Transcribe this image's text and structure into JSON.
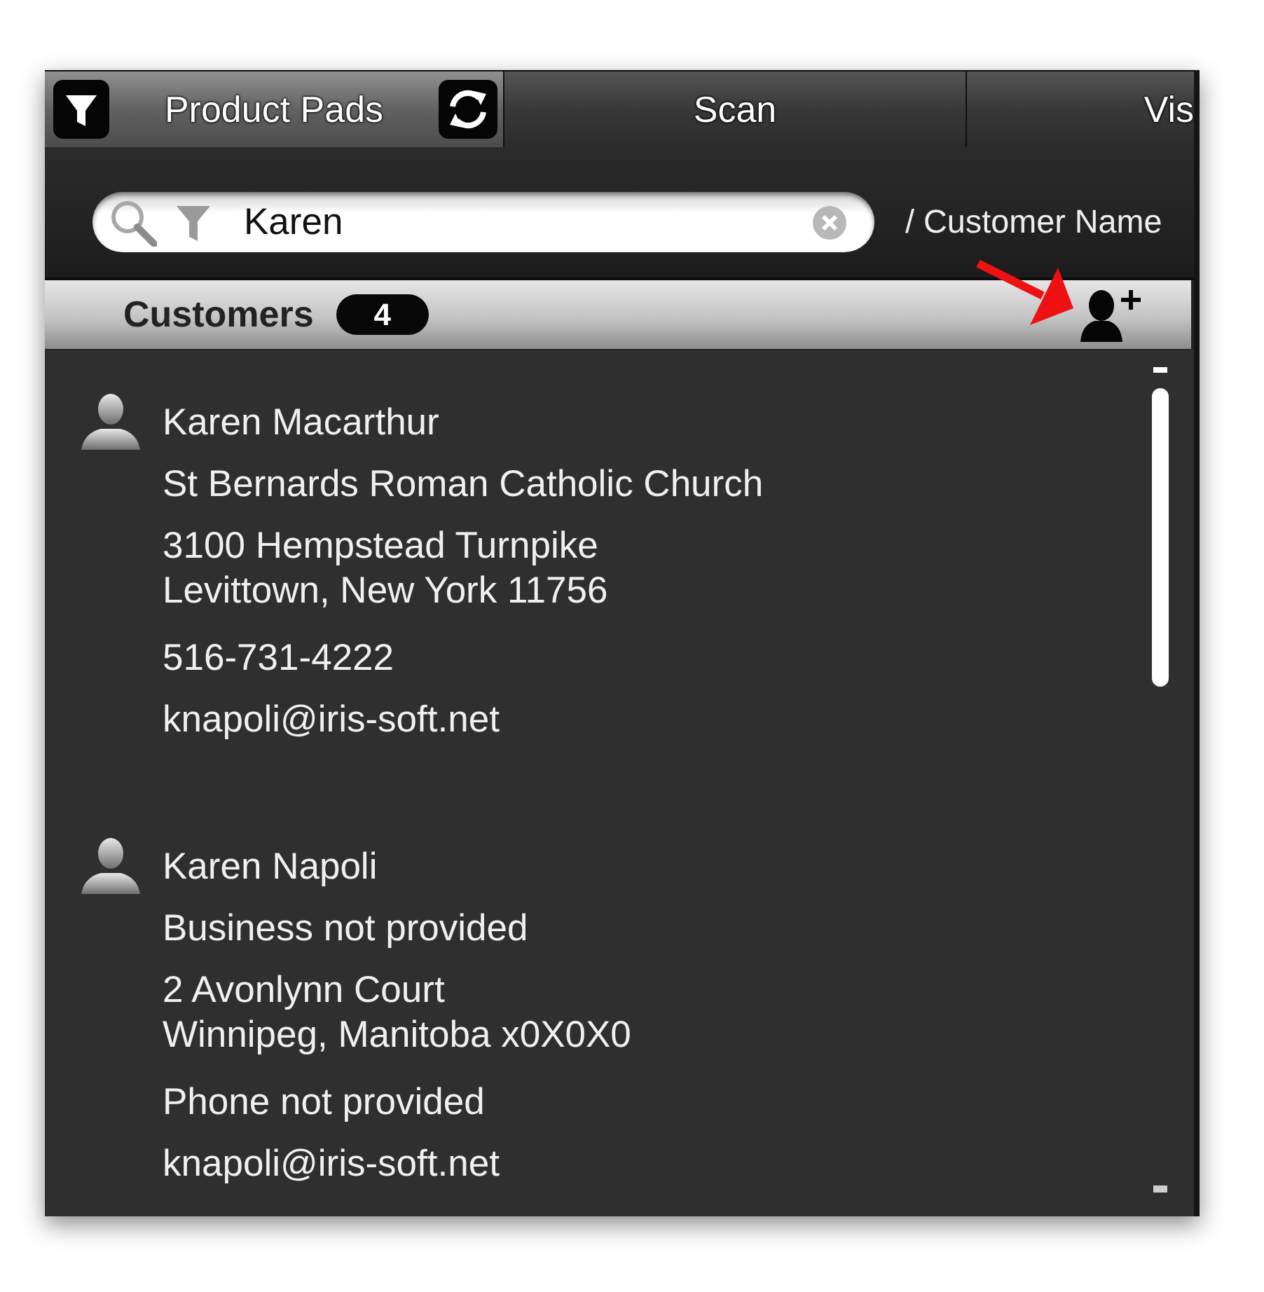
{
  "tabs": [
    {
      "label": "Product Pads",
      "selected": true
    },
    {
      "label": "Scan",
      "selected": false
    },
    {
      "label": "Vis",
      "selected": false
    }
  ],
  "search": {
    "value": "Karen",
    "field_label": "/ Customer Name"
  },
  "customers_header": {
    "title": "Customers",
    "count": "4"
  },
  "customers": [
    {
      "name": "Karen Macarthur",
      "business": "St Bernards Roman Catholic Church",
      "address": [
        "3100 Hempstead Turnpike",
        "Levittown, New York 11756"
      ],
      "phone": "516-731-4222",
      "email": "knapoli@iris-soft.net"
    },
    {
      "name": "Karen Napoli",
      "business": "Business not provided",
      "address": [
        "2 Avonlynn Court",
        "Winnipeg, Manitoba x0X0X0"
      ],
      "phone": "Phone not provided",
      "email": "knapoli@iris-soft.net"
    }
  ]
}
